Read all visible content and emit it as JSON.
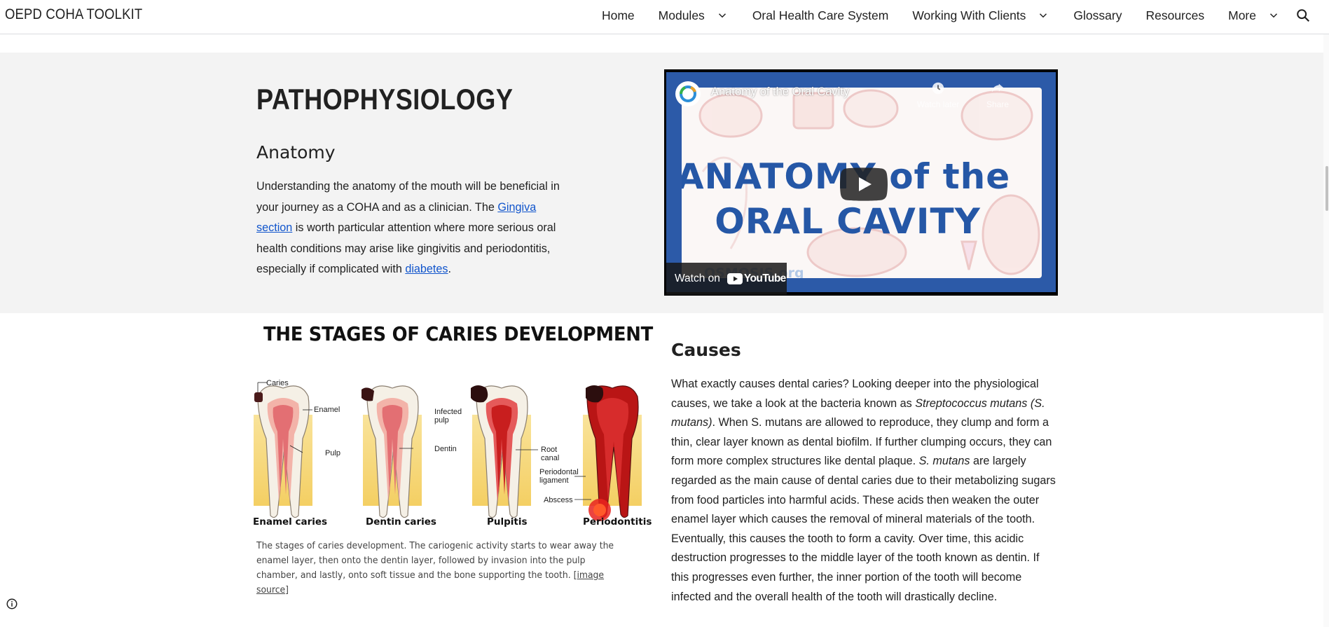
{
  "site": {
    "title": "OEPD COHA TOOLKIT"
  },
  "nav": {
    "items": [
      {
        "label": "Home",
        "dropdown": false
      },
      {
        "label": "Modules",
        "dropdown": true
      },
      {
        "label": "Oral Health Care System",
        "dropdown": false
      },
      {
        "label": "Working With Clients",
        "dropdown": true
      },
      {
        "label": "Glossary",
        "dropdown": false
      },
      {
        "label": "Resources",
        "dropdown": false
      },
      {
        "label": "More",
        "dropdown": true
      }
    ],
    "search_icon": "search-icon"
  },
  "hero": {
    "page_title": "PATHOPHYSIOLOGY",
    "heading": "Anatomy",
    "para": {
      "t1": "Understanding the anatomy of the mouth will be beneficial in your journey as a COHA and as a clinician. The ",
      "link1": "Gingiva section",
      "t2": " is worth particular attention where more serious oral health conditions may arise like gingivitis and periodontitis, especially if complicated with ",
      "link2": "diabetes",
      "t3": "."
    },
    "video": {
      "title": "Anatomy of the Oral Cavity",
      "watch_later": "Watch later",
      "share": "Share",
      "thumb_line1": "ANATOMY of the",
      "thumb_line2": "ORAL CAVITY",
      "watermark": "OSMOSIS.org",
      "watch_on": "Watch on",
      "youtube": "YouTube"
    }
  },
  "figure": {
    "title": "THE STAGES OF CARIES DEVELOPMENT",
    "stages": [
      "Enamel caries",
      "Dentin caries",
      "Pulpitis",
      "Periodontitis"
    ],
    "annotations": {
      "caries": "Caries",
      "enamel": "Enamel",
      "pulp": "Pulp",
      "dentin": "Dentin",
      "infected_pulp_1": "Infected",
      "infected_pulp_2": "pulp",
      "root_canal_1": "Root",
      "root_canal_2": "canal",
      "periodontal_1": "Periodontal",
      "periodontal_2": "ligament",
      "abscess": "Abscess"
    },
    "caption": "The stages of caries development. The cariogenic activity starts to wear away the enamel layer, then onto the dentin layer, followed by invasion into the pulp chamber, and lastly, onto soft tissue and the bone supporting the tooth. ",
    "caption_link": "[image source]"
  },
  "causes": {
    "heading": "Causes",
    "t1": "What exactly causes dental caries? Looking deeper into the physiological causes, we take a look at the bacteria known as ",
    "i1": "Streptococcus mutans (S. mutans)",
    "t2": ". When S. mutans are allowed to reproduce, they clump and form a thin, clear layer known as dental biofilm. If further clumping occurs, they can form more complex structures like dental plaque. ",
    "i2": "S. mutans",
    "t3": " are largely regarded as the main cause of dental caries due to their metabolizing sugars from food particles into harmful acids. These acids then weaken the outer enamel layer which causes the removal of mineral materials of the tooth. Eventually, this causes the tooth to form a cavity. Over time, this acidic destruction progresses to the middle layer of the tooth known as dentin. If this progresses even further, the inner portion of the tooth will become infected and the overall health of the tooth will drastically decline."
  },
  "colors": {
    "link": "#1155cc",
    "hero_bg": "#f3f3f3",
    "video_blue": "#2c5aa8",
    "thumb_text": "#2557a6"
  },
  "footer": {
    "info_icon": "info-icon"
  }
}
